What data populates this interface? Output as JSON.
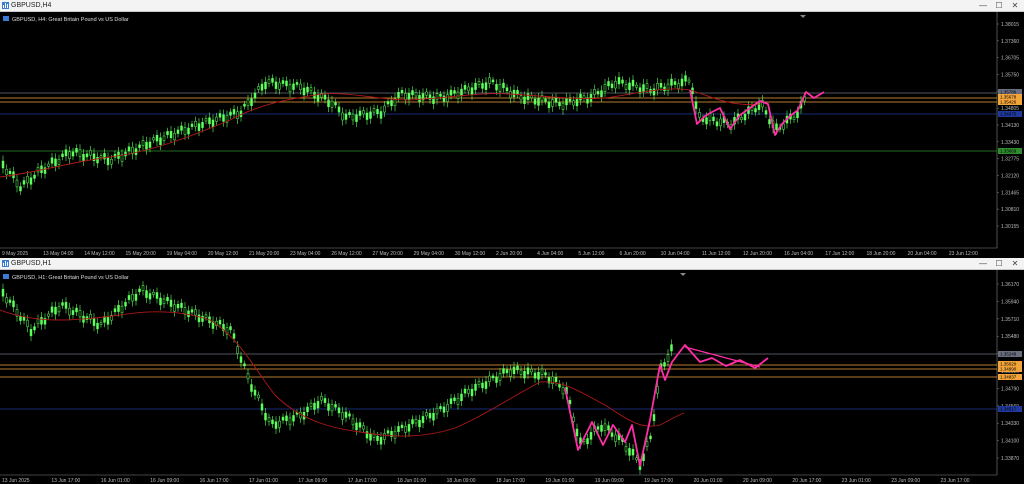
{
  "windows": [
    {
      "title": "GBPUSD,H4",
      "symbol_label": "GBPUSD, H4:  Great Britain Pound vs US Dollar",
      "price_axis": [
        "1.38015",
        "1.37360",
        "1.36705",
        "1.35750",
        "1.34950",
        "1.34805",
        "1.34130",
        "1.33430",
        "1.32775",
        "1.32120",
        "1.31465",
        "1.30810",
        "1.30155"
      ],
      "price_tags": [
        {
          "text": "1.35786",
          "color": "#6a6f80"
        },
        {
          "text": "1.35678",
          "color": "#f2a33a"
        },
        {
          "text": "1.35426",
          "color": "#f2a33a"
        },
        {
          "text": "1.34975",
          "color": "#1f3a9c"
        },
        {
          "text": "1.33669",
          "color": "#2e8b2e"
        }
      ],
      "time_axis": [
        "9 May 2025",
        "13 May 04:00",
        "14 May 12:00",
        "15 May 20:00",
        "19 May 04:00",
        "20 May 12:00",
        "21 May 20:00",
        "23 May 04:00",
        "26 May 12:00",
        "27 May 20:00",
        "29 May 04:00",
        "30 May 12:00",
        "2 Jun 20:00",
        "4 Jun 04:00",
        "5 Jun 12:00",
        "6 Jun 20:00",
        "10 Jun 04:00",
        "11 Jun 12:00",
        "12 Jun 20:00",
        "16 Jun 04:00",
        "17 Jun 12:00",
        "18 Jun 20:00",
        "20 Jun 04:00",
        "23 Jun 12:00"
      ]
    },
    {
      "title": "GBPUSD,H1",
      "symbol_label": "GBPUSD, H1:  Great Britain Pound vs US Dollar",
      "price_axis": [
        "1.36170",
        "1.35940",
        "1.35710",
        "1.35480",
        "1.35250",
        "1.35020",
        "1.34790",
        "1.34560",
        "1.34330",
        "1.34100",
        "1.33870"
      ],
      "price_tags": [
        {
          "text": "1.35248",
          "color": "#6a6f80"
        },
        {
          "text": "1.35020",
          "color": "#f2a33a"
        },
        {
          "text": "1.34990",
          "color": "#f2a33a"
        },
        {
          "text": "1.34837",
          "color": "#f2a33a"
        },
        {
          "text": "1.34517",
          "color": "#1f3a9c"
        }
      ],
      "time_axis": [
        "13 Jun 2025",
        "13 Jun 17:00",
        "16 Jun 01:00",
        "16 Jun 09:00",
        "16 Jun 17:00",
        "17 Jun 01:00",
        "17 Jun 09:00",
        "17 Jun 17:00",
        "18 Jun 01:00",
        "18 Jun 09:00",
        "18 Jun 17:00",
        "19 Jun 01:00",
        "19 Jun 09:00",
        "19 Jun 17:00",
        "20 Jun 01:00",
        "20 Jun 09:00",
        "20 Jun 17:00",
        "23 Jun 01:00",
        "23 Jun 09:00",
        "23 Jun 17:00"
      ]
    }
  ],
  "window_buttons": {
    "minimize": "—",
    "maximize": "☐",
    "close": "✕"
  },
  "colors": {
    "background": "#000000",
    "bull_candle": "#5cff5c",
    "moving_average": "#b01818",
    "drawing": "#ff2ea6",
    "support_orange": "#f2a33a",
    "line_blue": "#1f3a9c",
    "line_green": "#2e8b2e",
    "line_gray": "#6a6f80",
    "price_scale_text": "#bbbbbb"
  }
}
